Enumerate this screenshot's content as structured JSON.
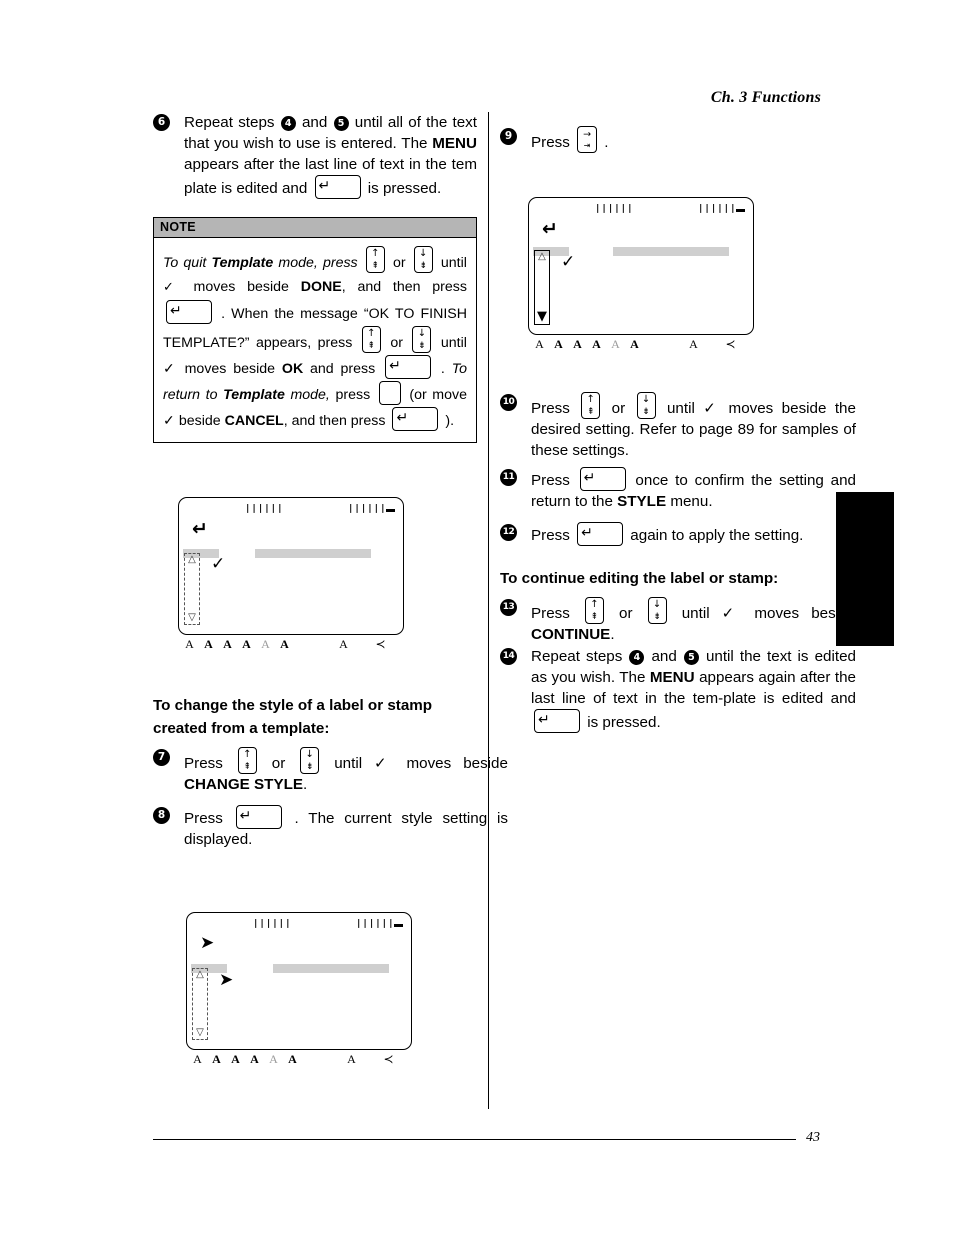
{
  "header": {
    "running_head": "Ch. 3 Functions"
  },
  "footer": {
    "page_number": "43"
  },
  "keys": {
    "up_top": "↑",
    "up_bottom": "⇞",
    "down_top": "↓",
    "down_bottom": "⇟",
    "enter": "↵",
    "tab_top": "→",
    "tab_bottom": "⇥",
    "blank": ""
  },
  "left_column": {
    "step6": {
      "number": "6",
      "text_a": "Repeat steps",
      "num_4": "4",
      "text_b": "and",
      "num_5": "5",
      "text_c": "until all of the text that you wish to use is entered. The",
      "bold_menu": "MENU",
      "text_d": "appears after the last line of text in the tem plate is edited and",
      "text_e": "is pressed."
    },
    "note": {
      "title": "NOTE",
      "l1_a": "To quit",
      "l1_b": "Template",
      "l1_c": "mode, press",
      "l1_d": "or",
      "l1_e": "until",
      "l2_a": "moves beside",
      "l2_b": "DONE",
      "l2_c": ", and then press",
      "l2_d": ".",
      "l3": "When the message “OK TO FINISH TEMPLATE?”",
      "l4_a": "appears, press",
      "l4_b": "or",
      "l4_c": "until ✓ moves beside",
      "l5_a": "OK",
      "l5_b": "and press",
      "l5_c": ".",
      "l5_d": "To return to",
      "l5_e": "Template",
      "l6_a": "mode,",
      "l6_b": "press",
      "l6_c": "(or move ✓ beside",
      "l6_d": "CANCEL",
      "l6_e": ", and",
      "l7_a": "then press",
      "l7_b": ")."
    },
    "lcd_top": {
      "name": "style-menu-display",
      "tick_left": "||||||",
      "tick_right": "||||||",
      "return_glyph": "↵",
      "check_glyph": "✓",
      "scroll_up": "△",
      "scroll_down": "▽",
      "status_icons": [
        "A",
        "A",
        "A",
        "A",
        "A",
        "A",
        "A",
        "≺"
      ]
    },
    "subhead": "To change the style of a label or stamp created from a template:",
    "step7": {
      "number": "7",
      "text_a": "Press",
      "text_b": "or",
      "text_c": "until ✓ moves beside",
      "bold": "CHANGE STYLE",
      "text_d": "."
    },
    "step8": {
      "number": "8",
      "text_a": "Press",
      "text_b": ". The current style setting is displayed."
    },
    "lcd_bottom": {
      "name": "style-setting-display",
      "tick_left": "||||||",
      "tick_right": "||||||",
      "arrow_glyph": "➤",
      "arrow_glyph2": "➤",
      "scroll_up": "△",
      "scroll_down": "▽",
      "status_icons": [
        "A",
        "A",
        "A",
        "A",
        "A",
        "A",
        "A",
        "≺"
      ]
    }
  },
  "right_column": {
    "step9": {
      "number": "9",
      "text_a": "Press",
      "text_b": "."
    },
    "lcd": {
      "name": "style-option-display",
      "tick_left": "||||||",
      "tick_right": "||||||",
      "return_glyph": "↵",
      "check_glyph": "✓",
      "scroll_up": "△",
      "scroll_down": "▼",
      "status_icons": [
        "A",
        "A",
        "A",
        "A",
        "A",
        "A",
        "A",
        "≺"
      ]
    },
    "step10": {
      "number": "10",
      "text_a": "Press",
      "text_b": "or",
      "text_c": "until ✓ moves beside the desired setting. Refer to page 89 for samples of these settings."
    },
    "step11": {
      "number": "11",
      "text_a": "Press",
      "text_b": "once to confirm the setting and return to the",
      "bold": "STYLE",
      "text_c": "menu."
    },
    "step12": {
      "number": "12",
      "text_a": "Press",
      "text_b": "again to apply the setting."
    },
    "subhead": "To continue editing the label or stamp:",
    "step13": {
      "number": "13",
      "text_a": "Press",
      "text_b": "or",
      "text_c": "until ✓ moves beside",
      "bold": "CONTINUE",
      "text_d": "."
    },
    "step14": {
      "number": "14",
      "text_a": "Repeat steps",
      "num_4": "4",
      "text_b": "and",
      "num_5": "5",
      "text_c": "until the text is edited as you wish. The",
      "bold_menu": "MENU",
      "text_d": "appears again after the last line of text in the tem-plate is edited and",
      "text_e": "is pressed."
    }
  }
}
